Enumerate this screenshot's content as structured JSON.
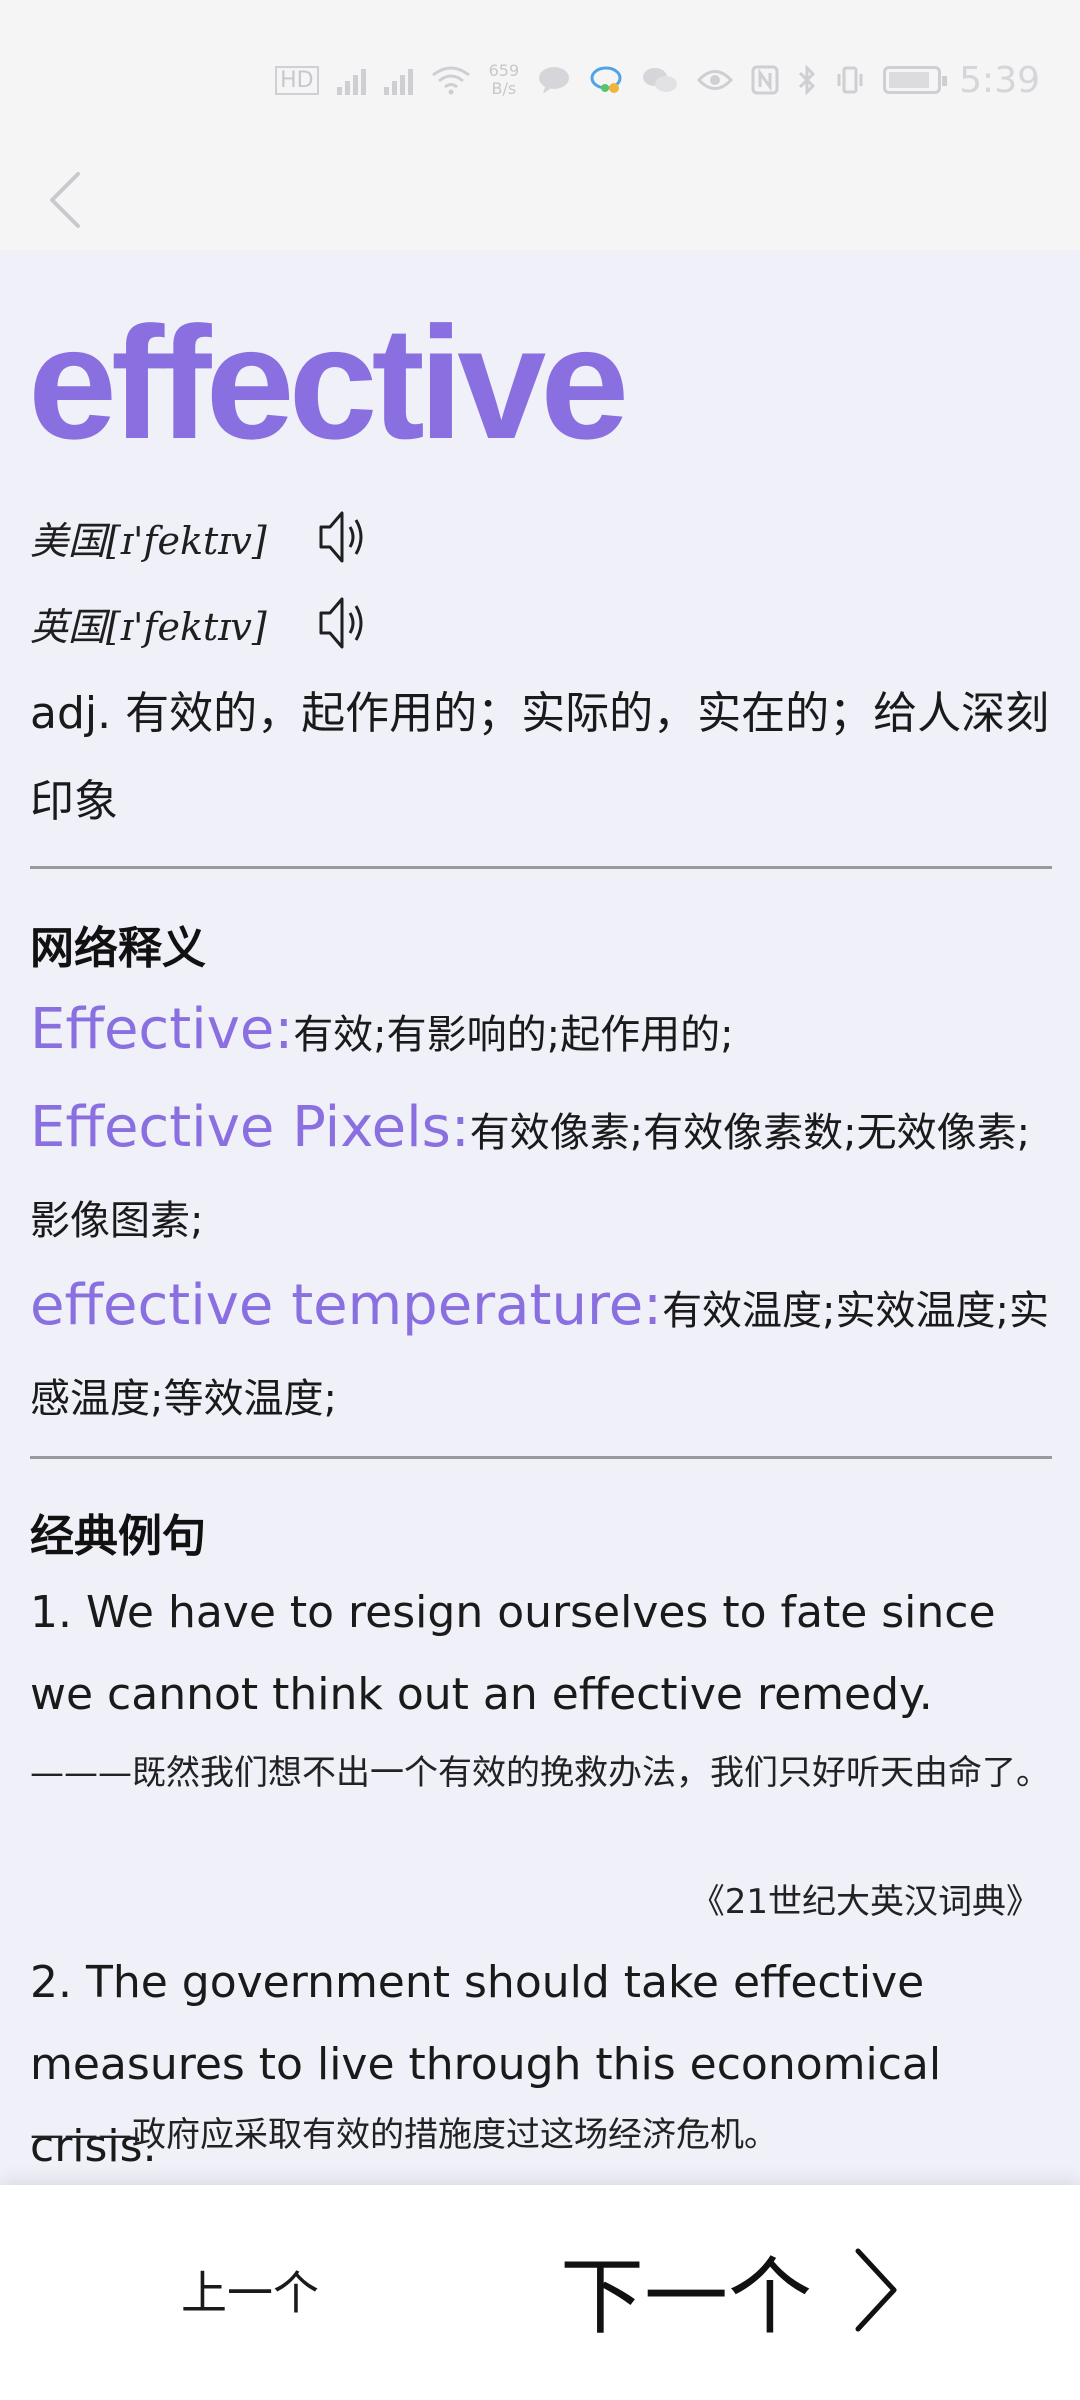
{
  "status_bar": {
    "left_badge": "HD",
    "net_speed_value": "659",
    "net_speed_unit": "B/s",
    "time": "5:39"
  },
  "word": {
    "headword": "effective",
    "pron_us": "美国[ɪ'fektɪv]",
    "pron_uk": "英国[ɪ'fektɪv]",
    "definition": "adj. 有效的，起作用的；实际的，实在的；给人深刻印象"
  },
  "web_definitions": {
    "title": "网络释义",
    "items": [
      {
        "term": "Effective:",
        "meaning": "有效;有影响的;起作用的;"
      },
      {
        "term": "Effective Pixels:",
        "meaning": "有效像素;有效像素数;无效像素;影像图素;"
      },
      {
        "term": "effective temperature:",
        "meaning": "有效温度;实效温度;实感温度;等效温度;"
      }
    ]
  },
  "examples": {
    "title": "经典例句",
    "items": [
      {
        "en": "1. We have to resign ourselves to fate since we cannot think out an effective remedy.",
        "zh": "———既然我们想不出一个有效的挽救办法，我们只好听天由命了。",
        "source": "《21世纪大英汉词典》"
      },
      {
        "en": "2. The government should take effective measures to live through this economical crisis.",
        "zh": "———政府应采取有效的措施度过这场经济危机。"
      }
    ]
  },
  "nav": {
    "prev_label": "上一个",
    "next_label": "下一个"
  },
  "colors": {
    "accent": "#8a6fe0",
    "background": "#eff0f8"
  }
}
